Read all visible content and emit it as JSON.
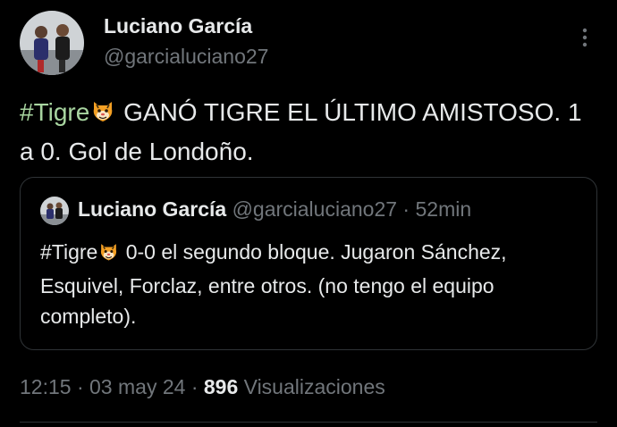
{
  "author": {
    "name": "Luciano García",
    "handle": "@garcialuciano27"
  },
  "tweet": {
    "hashtag": "#Tigre",
    "text": "GANÓ TIGRE EL ÚLTIMO AMISTOSO. 1 a 0. Gol de Londoño."
  },
  "quote": {
    "name": "Luciano García",
    "handle": "@garcialuciano27",
    "separator": "·",
    "time": "52min",
    "hashtag": "#Tigre",
    "text": "0-0 el segundo bloque. Jugaron Sánchez, Esquivel, Forclaz, entre otros. (no tengo el equipo completo)."
  },
  "meta": {
    "time": "12:15",
    "separator": "·",
    "date": "03 may 24",
    "views_count": "896",
    "views_label": "Visualizaciones"
  },
  "icons": {
    "more": "more-vertical-icon",
    "emoji": "tiger-face-emoji"
  },
  "colors": {
    "background": "#000000",
    "text_primary": "#e7e9ea",
    "text_secondary": "#71767b",
    "hashtag": "#a8d5a0",
    "border": "#2f3336"
  }
}
